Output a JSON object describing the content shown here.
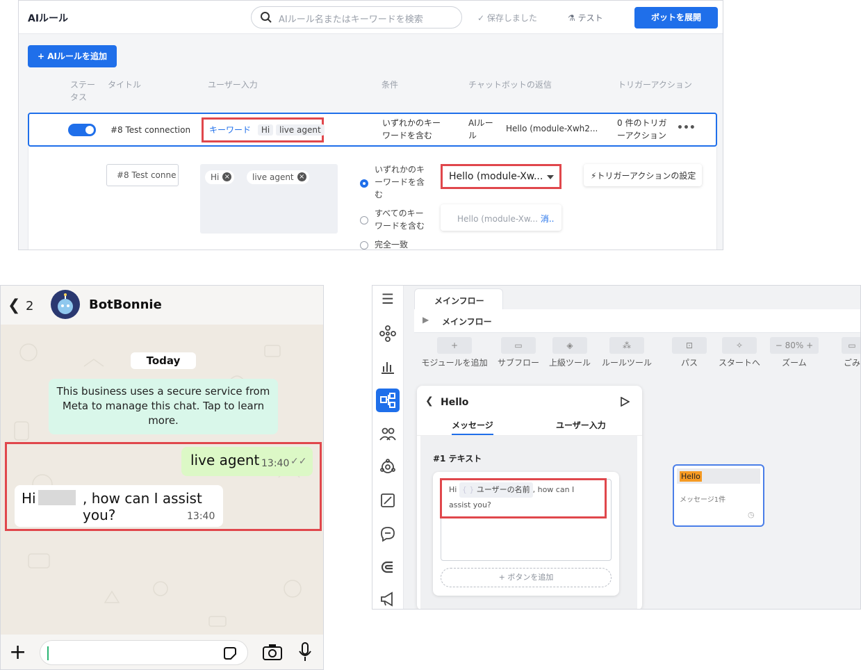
{
  "rules": {
    "title": "AIルール",
    "search_placeholder": "AIルール名またはキーワードを検索",
    "saved_label": "保存しました",
    "test_label": "テスト",
    "deploy_label": "ボットを展開",
    "add_label": "+ AIルールを追加",
    "columns": {
      "status": "ステータス",
      "title": "タイトル",
      "user_input": "ユーザー入力",
      "condition": "条件",
      "reply": "チャットボットの返信",
      "trigger": "トリガーアクション"
    },
    "row": {
      "title": "#8 Test connection",
      "kw_label": "キーワード",
      "kw1": "Hi",
      "kw2": "live agent",
      "condition": "いずれかのキーワードを含む",
      "reply_type": "AIルール",
      "reply_text": "Hello (module-Xwh2...",
      "trigger": "0 件のトリガーアクション",
      "more": "•••"
    },
    "edit": {
      "title_value": "#8 Test conne",
      "kw1": "Hi",
      "kw2": "live agent",
      "radio1": "いずれかのキーワードを含む",
      "radio2": "すべてのキーワードを含む",
      "radio3": "完全一致",
      "select_value": "Hello (module-Xw...",
      "preview": "Hello (module-Xw...",
      "preview_link": "消..",
      "trigger_btn": "トリガーアクションの設定"
    }
  },
  "chat": {
    "back_count": "2",
    "name": "BotBonnie",
    "date": "Today",
    "notice": "This business uses a secure service from Meta to manage this chat. Tap to learn more.",
    "sent_text": "live agent",
    "sent_time": "13:40",
    "recv_prefix": "Hi",
    "recv_suffix": ", how can I assist you?",
    "recv_time": "13:40"
  },
  "flow": {
    "tab": "メインフロー",
    "breadcrumb": "メインフロー",
    "tools": [
      "モジュールを追加",
      "サブフロー",
      "上級ツール",
      "ルールツール",
      "パス",
      "スタートへ",
      "ズーム",
      "ごみ"
    ],
    "zoom": "80%",
    "card_title": "Hello",
    "tab_message": "メッセージ",
    "tab_input": "ユーザー入力",
    "text_header": "#1 テキスト",
    "msg_hi": "Hi",
    "msg_var": "ユーザーの名前",
    "msg_rest": ", how can I",
    "msg_line2": "assist you?",
    "add_button": "+ ボタンを追加",
    "node_title": "Hello",
    "node_sub": "メッセージ1件"
  }
}
